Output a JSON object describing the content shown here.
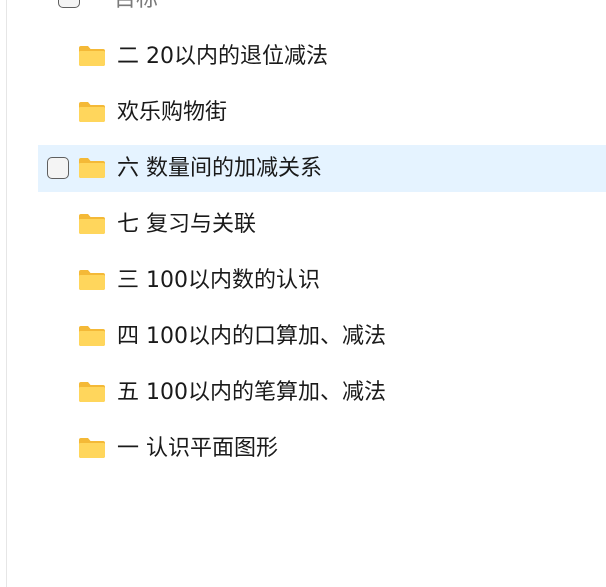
{
  "top_item": {
    "label": "目标"
  },
  "folders": [
    {
      "name": "二 20以内的退位减法",
      "selected": false
    },
    {
      "name": "欢乐购物街",
      "selected": false
    },
    {
      "name": "六 数量间的加减关系",
      "selected": true
    },
    {
      "name": "七 复习与关联",
      "selected": false
    },
    {
      "name": "三 100以内数的认识",
      "selected": false
    },
    {
      "name": "四 100以内的口算加、减法",
      "selected": false
    },
    {
      "name": "五 100以内的笔算加、减法",
      "selected": false
    },
    {
      "name": "一 认识平面图形",
      "selected": false
    }
  ],
  "colors": {
    "selection": "#e5f3ff",
    "folder_front": "#ffd65c",
    "folder_back": "#f4b937"
  },
  "icon": "folder-icon"
}
